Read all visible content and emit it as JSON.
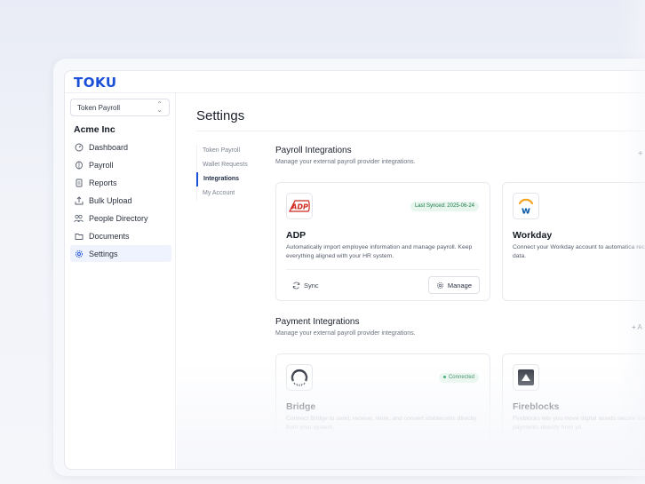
{
  "app": {
    "logo_text": "TOKU"
  },
  "sidebar": {
    "org_select": "Token Payroll",
    "company": "Acme Inc",
    "items": [
      {
        "label": "Dashboard",
        "icon": "gauge-icon"
      },
      {
        "label": "Payroll",
        "icon": "coin-icon"
      },
      {
        "label": "Reports",
        "icon": "report-icon"
      },
      {
        "label": "Bulk Upload",
        "icon": "upload-icon"
      },
      {
        "label": "People Directory",
        "icon": "people-icon"
      },
      {
        "label": "Documents",
        "icon": "folder-icon"
      },
      {
        "label": "Settings",
        "icon": "gear-icon",
        "active": true
      }
    ]
  },
  "page": {
    "title": "Settings"
  },
  "subnav": {
    "items": [
      "Token Payroll",
      "Wallet Requests",
      "Integrations",
      "My Account"
    ],
    "active": "Integrations"
  },
  "payroll_integrations": {
    "title": "Payroll Integrations",
    "subtitle": "Manage your external payroll provider integrations.",
    "add_label": "+",
    "cards": [
      {
        "name": "ADP",
        "badge": "Last Synced: 2025-06-24",
        "description": "Automatically import employee information and manage payroll. Keep everything aligned with your HR system.",
        "sync_label": "Sync",
        "manage_label": "Manage"
      },
      {
        "name": "Workday",
        "description": "Connect your Workday account to automatica records and compensation data."
      }
    ]
  },
  "payment_integrations": {
    "title": "Payment Integrations",
    "subtitle": "Manage your external payroll provider integrations.",
    "add_label": "+ A",
    "cards": [
      {
        "name": "Bridge",
        "badge": "Connected",
        "description": "Connect Bridge to send, receive, store, and convert stablecoins directly from your system."
      },
      {
        "name": "Fireblocks",
        "description": "Fireblocks lets you move digital assets secure integration to send payments directly from yo"
      }
    ]
  },
  "colors": {
    "accent": "#1a4fd8",
    "adp_red": "#d0271d",
    "badge_green": "#1b7a47"
  }
}
